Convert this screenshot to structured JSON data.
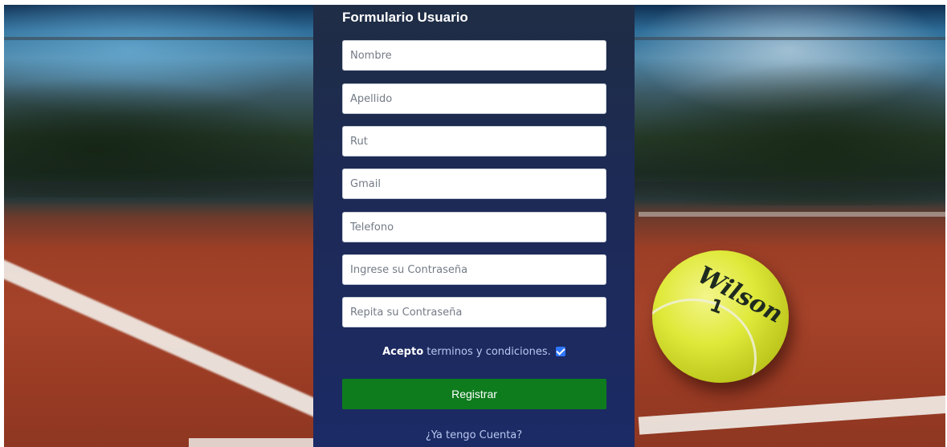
{
  "form": {
    "title": "Formulario Usuario",
    "fields": [
      {
        "placeholder": "Nombre"
      },
      {
        "placeholder": "Apellido"
      },
      {
        "placeholder": "Rut"
      },
      {
        "placeholder": "Gmail"
      },
      {
        "placeholder": "Telefono"
      },
      {
        "placeholder": "Ingrese su Contraseña"
      },
      {
        "placeholder": "Repita su Contraseña"
      }
    ],
    "terms": {
      "accept_label": "Acepto",
      "link_text": "terminos y condiciones.",
      "checked": true
    },
    "submit_label": "Registrar",
    "login_link": "¿Ya tengo Cuenta?"
  },
  "background": {
    "ball_brand": "Wilson",
    "ball_number": "1"
  },
  "colors": {
    "panel": "#1d2a55",
    "submit": "#0e7c1d",
    "checkbox": "#2f76ff",
    "link": "#b9c8f0"
  }
}
